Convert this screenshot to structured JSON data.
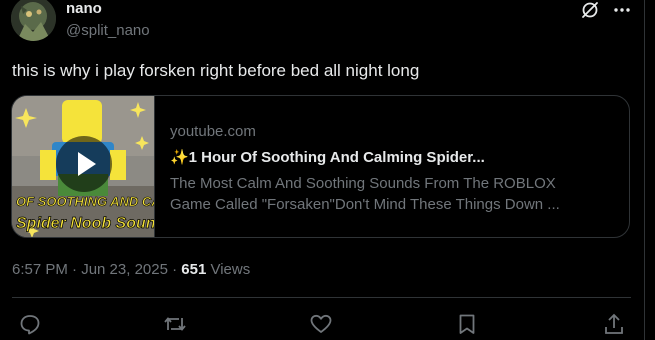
{
  "author": {
    "display_name": "nano",
    "handle": "@split_nano"
  },
  "tweet": {
    "text": "this is why i play forsken right before bed all night long"
  },
  "card": {
    "domain": "youtube.com",
    "title": "✨1 Hour Of Soothing And Calming Spider...",
    "description_line1": "The Most Calm And Soothing Sounds From The ROBLOX",
    "description_line2": "Game Called \"Forsaken\"Don't Mind These Things Down ...",
    "thumbnail_text_line1": "OF SOOTHING AND CA",
    "thumbnail_text_line2": "Spider Noob Sounds"
  },
  "meta": {
    "timestamp": "6:57 PM · Jun 23, 2025 · ",
    "views_count": "651",
    "views_label": " Views"
  },
  "icons": {
    "grok": "grok-icon",
    "more": "more-icon",
    "reply": "reply-icon",
    "retweet": "retweet-icon",
    "like": "heart-icon",
    "bookmark": "bookmark-icon",
    "share": "share-icon",
    "play": "play-icon"
  },
  "colors": {
    "background": "#000000",
    "text_primary": "#e7e9ea",
    "text_secondary": "#71767b",
    "border": "#2f3336"
  }
}
